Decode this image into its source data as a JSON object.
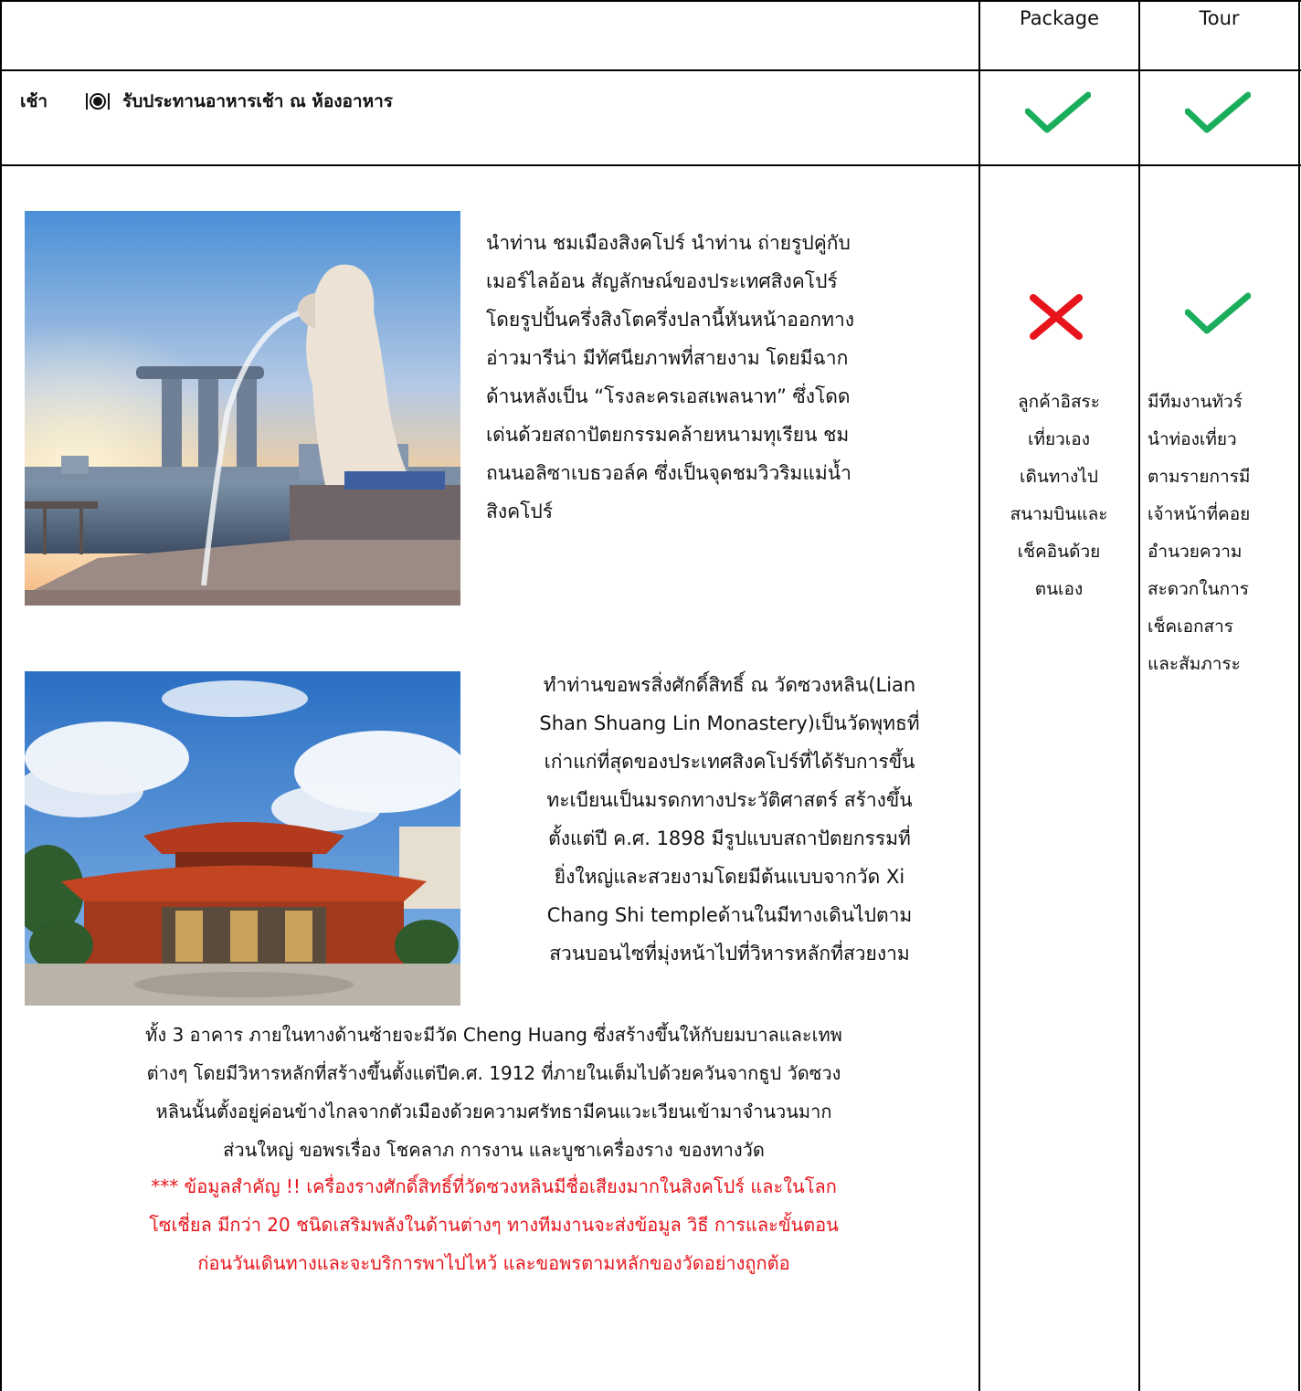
{
  "header": {
    "col_package": "Package",
    "col_tour": "Tour"
  },
  "breakfast": {
    "time": "เช้า",
    "icon": "dining-icon",
    "text": "รับประทานอาหารเช้า ณ ห้องอาหาร"
  },
  "merlion": {
    "lines": [
      "นำท่าน ชมเมืองสิงคโปร์ นำท่าน ถ่ายรูปคู่กับ",
      "เมอร์ไลอ้อน สัญลักษณ์ของประเทศสิงคโปร์",
      "โดยรูปปั้นครึ่งสิงโตครึ่งปลานี้หันหน้าออกทาง",
      "อ่าวมารีน่า มีทัศนียภาพที่สายงาม โดยมีฉาก",
      "ด้านหลังเป็น  “โรงละครเอสเพลนาท” ซึ่งโดด",
      "เด่นด้วยสถาปัตยกรรมคล้ายหนามทุเรียน ชม",
      "ถนนอลิซาเบธวอล์ค ซึ่งเป็นจุดชมวิวริมแม่น้ำ",
      "สิงคโปร์"
    ]
  },
  "temple": {
    "lines_right": [
      "ทำท่านขอพรสิ่งศักดิ์สิทธิ์ ณ วัดซวงหลิน(Lian",
      "Shan Shuang Lin Monastery)เป็นวัดพุทธที่",
      "เก่าแก่ที่สุดของประเทศสิงคโปร์ที่ได้รับการขึ้น",
      "ทะเบียนเป็นมรดกทางประวัติศาสตร์ สร้างขึ้น",
      "ตั้งแต่ปี ค.ศ. 1898 มีรูปแบบสถาปัตยกรรมที่",
      "ยิ่งใหญ่และสวยงามโดยมีต้นแบบจากวัด Xi",
      "Chang Shi templeด้านในมีทางเดินไปตาม",
      "สวนบอนไซที่มุ่งหน้าไปที่วิหารหลักที่สวยงาม"
    ],
    "lines_full": [
      "ทั้ง 3 อาคาร ภายในทางด้านซ้ายจะมีวัด Cheng Huang ซึ่งสร้างขึ้นให้กับยมบาลและเทพ",
      "ต่างๆ โดยมีวิหารหลักที่สร้างขึ้นตั้งแต่ปีค.ศ. 1912 ที่ภายในเต็มไปด้วยควันจากธูป วัดซวง",
      "หลินนั้นตั้งอยู่ค่อนข้างไกลจากตัวเมืองด้วยความศรัทธามีคนแวะเวียนเข้ามาจำนวนมาก",
      "ส่วนใหญ่ ขอพรเรื่อง โชคลาภ การงาน และบูชาเครื่องราง ของทางวัด"
    ],
    "lines_red": [
      "*** ข้อมูลสำคัญ !! เครื่องรางศักดิ์สิทธิ์ที่วัดซวงหลินมีชื่อเสียงมากในสิงคโปร์ และในโลก",
      "โซเชี่ยล มีกว่า 20 ชนิดเสริมพลังในด้านต่างๆ ทางทีมงานจะส่งข้อมูล วิธี การและขั้นตอน",
      "ก่อนวันเดินทางและจะบริการพาไปไหว้ และขอพรตามหลักของวัดอย่างถูกต้อ"
    ]
  },
  "package_note": [
    "ลูกค้าอิสระ",
    "เที่ยวเอง",
    "เดินทางไป",
    "สนามบินและ",
    "เช็คอินด้วย",
    "ตนเอง"
  ],
  "tour_note": [
    "มีทีมงานทัวร์",
    "นำท่องเที่ยว",
    "ตามรายการมี",
    "เจ้าหน้าที่คอย",
    "อำนวยความ",
    "สะดวกในการ",
    "เช็คเอกสาร",
    "และสัมภาระ"
  ],
  "colors": {
    "check": "#1aae5c",
    "cross": "#e8141b",
    "important": "#e8141b"
  }
}
